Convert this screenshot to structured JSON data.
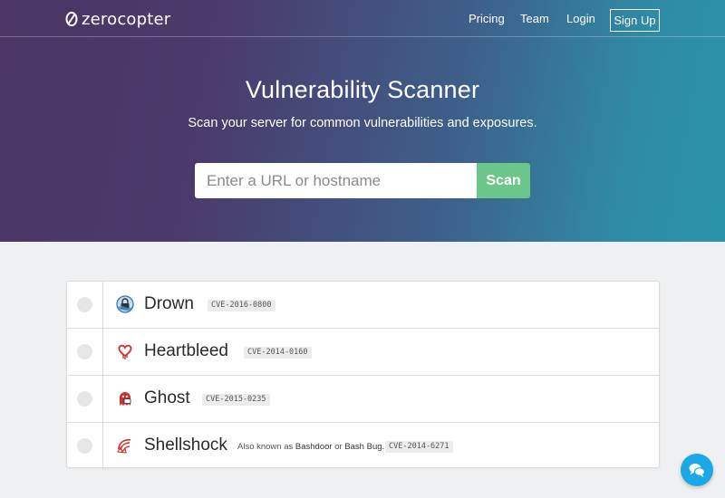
{
  "brand": {
    "name": "zerocopter",
    "logo_icon": "slashed-circle-icon"
  },
  "nav": {
    "links": [
      "Pricing",
      "Team",
      "Login"
    ],
    "signup_label": "Sign Up"
  },
  "hero": {
    "title": "Vulnerability Scanner",
    "subtitle": "Scan your server for common vulnerabilities and exposures.",
    "search": {
      "placeholder": "Enter a URL or hostname",
      "value": ""
    },
    "scan_label": "Scan"
  },
  "vulnerabilities": [
    {
      "name": "Drown",
      "cve": "CVE-2016-0800",
      "icon": "padlock-icon"
    },
    {
      "name": "Heartbleed",
      "cve": "CVE-2014-0160",
      "icon": "bleeding-heart-icon"
    },
    {
      "name": "Ghost",
      "cve": "CVE-2015-0235",
      "icon": "ghost-icon"
    },
    {
      "name": "Shellshock",
      "cve": "CVE-2014-6271",
      "icon": "shell-icon",
      "aka": {
        "prefix": "Also known as",
        "name1": "Bashdoor",
        "joiner": "or",
        "name2": "Bash Bug."
      }
    }
  ],
  "colors": {
    "scan_button": "#6cc58a",
    "chat_button": "#1ba9e5",
    "icon_red": "#d0302b"
  },
  "chat": {
    "icon": "chat-bubbles-icon"
  }
}
